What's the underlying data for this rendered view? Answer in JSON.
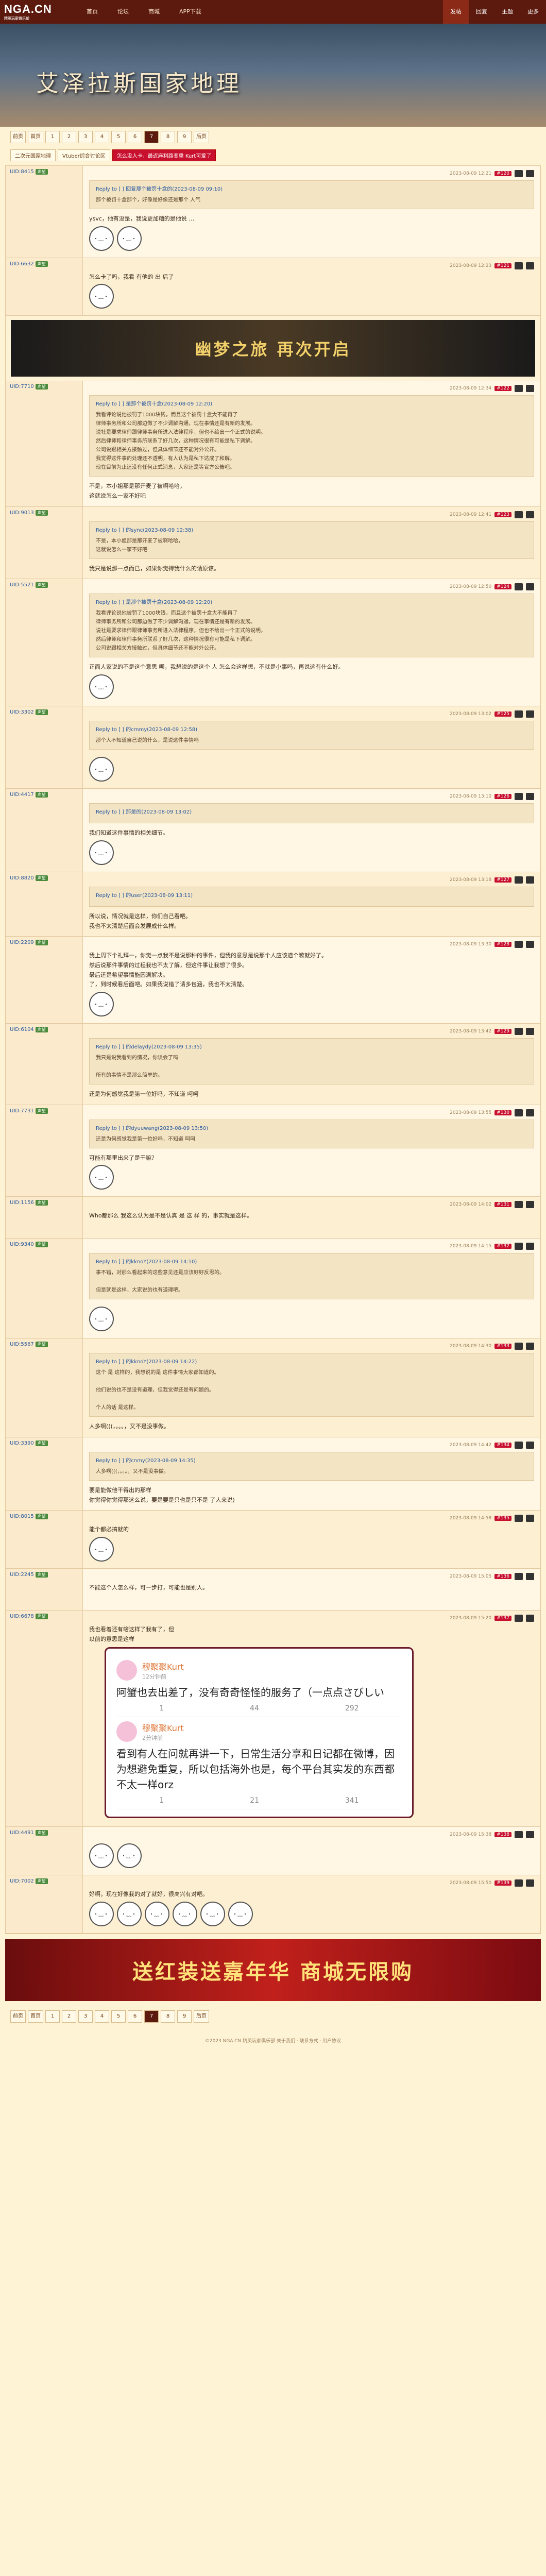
{
  "site": {
    "logo": "NGA.CN",
    "logo_sub": "精英玩家俱乐部"
  },
  "topnav": [
    "首页",
    "论坛",
    "商城",
    "APP下载"
  ],
  "topright": [
    {
      "label": "发帖",
      "active": true
    },
    {
      "label": "回复",
      "active": false
    },
    {
      "label": "主题",
      "active": false
    },
    {
      "label": "更多",
      "active": false
    }
  ],
  "banner_title": "艾泽拉斯国家地理",
  "pager": [
    "前页",
    "首页",
    "1",
    "2",
    "3",
    "4",
    "5",
    "6",
    "7",
    "8",
    "9",
    "后页"
  ],
  "current_page": "7",
  "crumbs": [
    "二次元国家地理",
    "Vtuber综合讨论区",
    "怎么没人卡，最近麻利路变重 Kurt可爱了"
  ],
  "ad_top": "幽梦之旅 再次开启",
  "ad_bottom": "送红装送嘉年华 商城无限购",
  "posts": [
    {
      "user": "UID:8415",
      "lv": "声望",
      "flr": "#120",
      "time": "2023-08-09 12:21",
      "quote_head": "Reply to [ ] 回复那个被罚十盒的(2023-08-09 09:10)",
      "quote": "那个被罚十盒那个，好像是好像还是那个 人气",
      "text": "ysvc，他有没是，我说更加糟的是他说 …",
      "stickers": 2
    },
    {
      "user": "UID:6632",
      "lv": "声望",
      "flr": "#121",
      "time": "2023-08-09 12:23",
      "text": "怎么卡了吗，我看 有他的 出 后了",
      "stickers": 1
    },
    {
      "user": "UID:7710",
      "lv": "声望",
      "flr": "#122",
      "time": "2023-08-09 12:34",
      "quote_head": "Reply to [ ] 是那个被罚十盒(2023-08-09 12:20)",
      "quote": "我看评论说他被罚了1000块钱，而且这个被罚十盒大不能再了\n律师事务所和公司那边做了不少调解沟通，现在事情还是有新的发展。\n说社是要求律师跟律师事务所进入法律程序，但也不给出一个正式的说明。\n然后律师和律师事务所联系了好几次，这种情况很有可能是私下调解。\n公司说跟相关方接触过，但具体细节还不能对外公开。\n我觉得这件事的处理还不透明，有人认为是私下达成了和解。\n现在目前为止还没有任何正式消息，大家还是等官方公告吧。",
      "text": "不是，本小姐那是那开麦了被啊哈哈，\n这就说怎么一家不好吧",
      "stickers": 0
    },
    {
      "user": "UID:9013",
      "lv": "声望",
      "flr": "#123",
      "time": "2023-08-09 12:41",
      "quote_head": "Reply to [ ] 的sync(2023-08-09 12:38)",
      "quote": "不是，本小姐那是那开麦了被啊哈哈，\n这就说怎么一家不好吧",
      "text": "我只是说那一点而已，如果你觉得我什么的请原谅。",
      "stickers": 0
    },
    {
      "user": "UID:5521",
      "lv": "声望",
      "flr": "#124",
      "time": "2023-08-09 12:50",
      "quote_head": "Reply to [ ] 是那个被罚十盒(2023-08-09 12:20)",
      "quote": "我看评论说他被罚了1000块钱，而且这个被罚十盒大不能再了\n律师事务所和公司那边做了不少调解沟通，现在事情还是有新的发展。\n说社是要求律师跟律师事务所进入法律程序，但也不给出一个正式的说明。\n然后律师和律师事务所联系了好几次，这种情况很有可能是私下调解。\n公司说跟相关方接触过，但具体细节还不能对外公开。",
      "text": "正面人家说的不是这个意思 呗，我想说的是这个 人 怎么会这样想，不就是小事吗，再说这有什么好。",
      "stickers": 1
    },
    {
      "user": "UID:3302",
      "lv": "声望",
      "flr": "#125",
      "time": "2023-08-09 13:02",
      "quote_head": "Reply to [ ] 的cmmy(2023-08-09 12:58)",
      "quote": "那个人不知道自己说的什么，是说这件事情吗",
      "text": "",
      "stickers": 1
    },
    {
      "user": "UID:4417",
      "lv": "声望",
      "flr": "#126",
      "time": "2023-08-09 13:10",
      "quote_head": "Reply to [ ] 那是的(2023-08-09 13:02)",
      "quote": "",
      "text": "我们知道这件事情的相关细节。",
      "stickers": 1
    },
    {
      "user": "UID:8820",
      "lv": "声望",
      "flr": "#127",
      "time": "2023-08-09 13:18",
      "quote_head": "Reply to [ ] 的user(2023-08-09 13:11)",
      "quote": "",
      "text": "所以说，情况就是这样，你们自己看吧。\n我也不太清楚后面会发展成什么样。",
      "stickers": 0
    },
    {
      "user": "UID:2209",
      "lv": "声望",
      "flr": "#128",
      "time": "2023-08-09 13:30",
      "quote_head": "",
      "quote": "",
      "text": "我上周下个礼拜一，你觉一点我不是说那种的事件，但我的意思是说那个人应该道个歉就好了。\n然后说那件事情的过程我也不太了解，但这件事让我想了很多。\n最后还是希望事情能圆满解决。\n了，到时候看后面吧。如果我说错了请多包涵，我也不太清楚。",
      "stickers": 1
    },
    {
      "user": "UID:6104",
      "lv": "声望",
      "flr": "#129",
      "time": "2023-08-09 13:42",
      "quote_head": "Reply to [ ] 的delaydy(2023-08-09 13:35)",
      "quote": "我只是说我看到的情况，你误会了吗\n\n所有的事情不是那么简单的。",
      "text": "还是为何感觉我是第一位好吗，不知道 呵呵",
      "stickers": 0
    },
    {
      "user": "UID:7731",
      "lv": "声望",
      "flr": "#130",
      "time": "2023-08-09 13:55",
      "quote_head": "Reply to [ ] 的dyuuwang(2023-08-09 13:50)",
      "quote": "还是为何感觉我是第一位好吗，不知道 呵呵",
      "text": "可能有那里出来了是干嘛？",
      "stickers": 1
    },
    {
      "user": "UID:1156",
      "lv": "声望",
      "flr": "#131",
      "time": "2023-08-09 14:02",
      "quote_head": "",
      "quote": "",
      "text": "Who都那么 我这么认为是不是认真 是 这 样 的，事实就是这样。",
      "stickers": 0
    },
    {
      "user": "UID:9340",
      "lv": "声望",
      "flr": "#132",
      "time": "2023-08-09 14:15",
      "quote_head": "Reply to [ ] 的kknoY(2023-08-09 14:10)",
      "quote": "事不错，对那么看起来的这些意见还是应该好好反思的。\n\n但是就是这样，大家说的也有道理吧。",
      "text": "",
      "stickers": 1
    },
    {
      "user": "UID:5567",
      "lv": "声望",
      "flr": "#133",
      "time": "2023-08-09 14:30",
      "quote_head": "Reply to [ ] 的kknoY(2023-08-09 14:22)",
      "quote": "这个 是 这样的，我想说的是 这件事情大家都知道的。\n\n他们说的也不是没有道理，但我觉得还是有问题的。\n\n个人的话 是这样。",
      "text": "人多啊(((，。。。，又不是没事做。",
      "stickers": 0
    },
    {
      "user": "UID:3390",
      "lv": "声望",
      "flr": "#134",
      "time": "2023-08-09 14:42",
      "quote_head": "Reply to [ ] 的cnmy(2023-08-09 14:35)",
      "quote": "人多啊(((，。。。，又不是没事做。",
      "text": "要是能做他干得出的那样\n你觉得你觉得那这么说，要是要是只也是只不是 了人来说)",
      "stickers": 0
    },
    {
      "user": "UID:8015",
      "lv": "声望",
      "flr": "#135",
      "time": "2023-08-09 14:58",
      "quote_head": "",
      "quote": "",
      "text": "能个都必搞就的",
      "stickers": 1
    },
    {
      "user": "UID:2245",
      "lv": "声望",
      "flr": "#136",
      "time": "2023-08-09 15:05",
      "quote_head": "",
      "quote": "",
      "text": "不能这个人怎么样，可一步打，可能也是别人。",
      "stickers": 0
    },
    {
      "user": "UID:6678",
      "lv": "声望",
      "flr": "#137",
      "time": "2023-08-09 15:20",
      "quote_head": "",
      "quote": "",
      "text": "我也看着还有啥这样了我有了，但\n以前的意思是这样\n",
      "stickers": 0,
      "weibo": true
    },
    {
      "user": "UID:4491",
      "lv": "声望",
      "flr": "#138",
      "time": "2023-08-09 15:38",
      "quote_head": "",
      "quote": "",
      "text": "",
      "stickers": 2
    },
    {
      "user": "UID:7002",
      "lv": "声望",
      "flr": "#139",
      "time": "2023-08-09 15:50",
      "quote_head": "",
      "quote": "",
      "text": "好啊，现在好像我的对了就好，很高兴有对吧。",
      "stickers": 6
    }
  ],
  "weibo": [
    {
      "name": "穆聚聚Kurt",
      "time": "12分钟前",
      "text": "阿蟹也去出差了，没有奇奇怪怪的服务了（一点点さびしい",
      "stats": [
        "1",
        "44",
        "292"
      ]
    },
    {
      "name": "穆聚聚Kurt",
      "time": "2分钟前",
      "text": "看到有人在问就再讲一下，日常生活分享和日记都在微博，因为想避免重复，所以包括海外也是，每个平台其实发的东西都不太一样orz",
      "stats": [
        "1",
        "21",
        "341"
      ]
    }
  ],
  "footer": "©2023 NGA.CN 精英玩家俱乐部  关于我们 · 联系方式 · 用户协议"
}
